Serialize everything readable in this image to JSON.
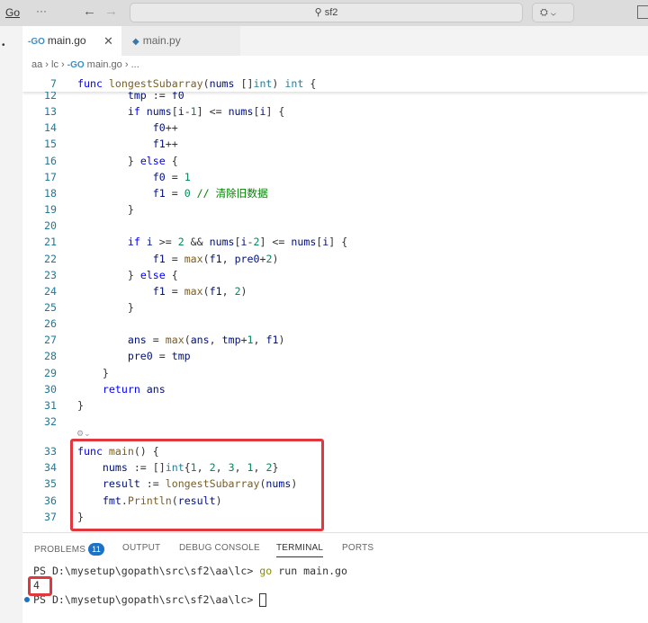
{
  "titlebar": {
    "menu": "Go",
    "more": "···",
    "search": "sf2"
  },
  "tabs": [
    {
      "label": "main.go",
      "icon": "go-icon",
      "active": true
    },
    {
      "label": "main.py",
      "icon": "python-icon",
      "active": false
    }
  ],
  "breadcrumb": [
    "aa",
    "lc",
    "main.go",
    "..."
  ],
  "sticky": {
    "num": "7",
    "tokens": [
      [
        "kw",
        "func "
      ],
      [
        "fn",
        "longestSubarray"
      ],
      [
        "pl",
        "("
      ],
      [
        "id",
        "nums "
      ],
      [
        "pl",
        "[]"
      ],
      [
        "ty",
        "int"
      ],
      [
        "pl",
        ") "
      ],
      [
        "ty",
        "int"
      ],
      [
        "pl",
        " {"
      ]
    ]
  },
  "lines": [
    {
      "num": "12",
      "tokens": [
        [
          "pl",
          "        "
        ],
        [
          "id",
          "tmp"
        ],
        [
          "pl",
          " := "
        ],
        [
          "id",
          "f0"
        ]
      ]
    },
    {
      "num": "13",
      "tokens": [
        [
          "pl",
          "        "
        ],
        [
          "kw",
          "if "
        ],
        [
          "id",
          "nums"
        ],
        [
          "pl",
          "["
        ],
        [
          "id",
          "i"
        ],
        [
          "pl",
          "-"
        ],
        [
          "num",
          "1"
        ],
        [
          "pl",
          "] <= "
        ],
        [
          "id",
          "nums"
        ],
        [
          "pl",
          "["
        ],
        [
          "id",
          "i"
        ],
        [
          "pl",
          "] {"
        ]
      ]
    },
    {
      "num": "14",
      "tokens": [
        [
          "pl",
          "            "
        ],
        [
          "id",
          "f0"
        ],
        [
          "pl",
          "++"
        ]
      ]
    },
    {
      "num": "15",
      "tokens": [
        [
          "pl",
          "            "
        ],
        [
          "id",
          "f1"
        ],
        [
          "pl",
          "++"
        ]
      ]
    },
    {
      "num": "16",
      "tokens": [
        [
          "pl",
          "        } "
        ],
        [
          "kw",
          "else"
        ],
        [
          "pl",
          " {"
        ]
      ]
    },
    {
      "num": "17",
      "tokens": [
        [
          "pl",
          "            "
        ],
        [
          "id",
          "f0"
        ],
        [
          "pl",
          " = "
        ],
        [
          "num",
          "1"
        ]
      ]
    },
    {
      "num": "18",
      "tokens": [
        [
          "pl",
          "            "
        ],
        [
          "id",
          "f1"
        ],
        [
          "pl",
          " = "
        ],
        [
          "num",
          "0"
        ],
        [
          "cm",
          " // 清除旧数据"
        ]
      ]
    },
    {
      "num": "19",
      "tokens": [
        [
          "pl",
          "        }"
        ]
      ]
    },
    {
      "num": "20",
      "tokens": []
    },
    {
      "num": "21",
      "tokens": [
        [
          "pl",
          "        "
        ],
        [
          "kw",
          "if "
        ],
        [
          "id",
          "i"
        ],
        [
          "pl",
          " >= "
        ],
        [
          "num",
          "2"
        ],
        [
          "pl",
          " && "
        ],
        [
          "id",
          "nums"
        ],
        [
          "pl",
          "["
        ],
        [
          "id",
          "i"
        ],
        [
          "pl",
          "-"
        ],
        [
          "num",
          "2"
        ],
        [
          "pl",
          "] <= "
        ],
        [
          "id",
          "nums"
        ],
        [
          "pl",
          "["
        ],
        [
          "id",
          "i"
        ],
        [
          "pl",
          "] {"
        ]
      ]
    },
    {
      "num": "22",
      "tokens": [
        [
          "pl",
          "            "
        ],
        [
          "id",
          "f1"
        ],
        [
          "pl",
          " = "
        ],
        [
          "fn",
          "max"
        ],
        [
          "pl",
          "("
        ],
        [
          "id",
          "f1"
        ],
        [
          "pl",
          ", "
        ],
        [
          "id",
          "pre0"
        ],
        [
          "pl",
          "+"
        ],
        [
          "num",
          "2"
        ],
        [
          "pl",
          ")"
        ]
      ]
    },
    {
      "num": "23",
      "tokens": [
        [
          "pl",
          "        } "
        ],
        [
          "kw",
          "else"
        ],
        [
          "pl",
          " {"
        ]
      ]
    },
    {
      "num": "24",
      "tokens": [
        [
          "pl",
          "            "
        ],
        [
          "id",
          "f1"
        ],
        [
          "pl",
          " = "
        ],
        [
          "fn",
          "max"
        ],
        [
          "pl",
          "("
        ],
        [
          "id",
          "f1"
        ],
        [
          "pl",
          ", "
        ],
        [
          "num",
          "2"
        ],
        [
          "pl",
          ")"
        ]
      ]
    },
    {
      "num": "25",
      "tokens": [
        [
          "pl",
          "        }"
        ]
      ]
    },
    {
      "num": "26",
      "tokens": []
    },
    {
      "num": "27",
      "tokens": [
        [
          "pl",
          "        "
        ],
        [
          "id",
          "ans"
        ],
        [
          "pl",
          " = "
        ],
        [
          "fn",
          "max"
        ],
        [
          "pl",
          "("
        ],
        [
          "id",
          "ans"
        ],
        [
          "pl",
          ", "
        ],
        [
          "id",
          "tmp"
        ],
        [
          "pl",
          "+"
        ],
        [
          "num",
          "1"
        ],
        [
          "pl",
          ", "
        ],
        [
          "id",
          "f1"
        ],
        [
          "pl",
          ")"
        ]
      ]
    },
    {
      "num": "28",
      "tokens": [
        [
          "pl",
          "        "
        ],
        [
          "id",
          "pre0"
        ],
        [
          "pl",
          " = "
        ],
        [
          "id",
          "tmp"
        ]
      ]
    },
    {
      "num": "29",
      "tokens": [
        [
          "pl",
          "    }"
        ]
      ]
    },
    {
      "num": "30",
      "tokens": [
        [
          "pl",
          "    "
        ],
        [
          "kw",
          "return "
        ],
        [
          "id",
          "ans"
        ]
      ]
    },
    {
      "num": "31",
      "tokens": [
        [
          "pl",
          "}"
        ]
      ]
    },
    {
      "num": "32",
      "tokens": []
    },
    {
      "num": "33",
      "tokens": [
        [
          "kw",
          "func "
        ],
        [
          "fn",
          "main"
        ],
        [
          "pl",
          "() {"
        ]
      ]
    },
    {
      "num": "34",
      "tokens": [
        [
          "pl",
          "    "
        ],
        [
          "id",
          "nums"
        ],
        [
          "pl",
          " := []"
        ],
        [
          "ty",
          "int"
        ],
        [
          "pl",
          "{"
        ],
        [
          "num",
          "1"
        ],
        [
          "pl",
          ", "
        ],
        [
          "num",
          "2"
        ],
        [
          "pl",
          ", "
        ],
        [
          "num",
          "3"
        ],
        [
          "pl",
          ", "
        ],
        [
          "num",
          "1"
        ],
        [
          "pl",
          ", "
        ],
        [
          "num",
          "2"
        ],
        [
          "pl",
          "}"
        ]
      ]
    },
    {
      "num": "35",
      "tokens": [
        [
          "pl",
          "    "
        ],
        [
          "id",
          "result"
        ],
        [
          "pl",
          " := "
        ],
        [
          "fn",
          "longestSubarray"
        ],
        [
          "pl",
          "("
        ],
        [
          "id",
          "nums"
        ],
        [
          "pl",
          ")"
        ]
      ]
    },
    {
      "num": "36",
      "tokens": [
        [
          "pl",
          "    "
        ],
        [
          "id",
          "fmt"
        ],
        [
          "pl",
          "."
        ],
        [
          "fn",
          "Println"
        ],
        [
          "pl",
          "("
        ],
        [
          "id",
          "result"
        ],
        [
          "pl",
          ")"
        ]
      ]
    },
    {
      "num": "37",
      "tokens": [
        [
          "pl",
          "}"
        ]
      ]
    }
  ],
  "panel": {
    "tabs": [
      "PROBLEMS",
      "OUTPUT",
      "DEBUG CONSOLE",
      "TERMINAL",
      "PORTS"
    ],
    "problems_count": "11",
    "active": "TERMINAL"
  },
  "terminal": {
    "prompt": "PS D:\\mysetup\\gopath\\src\\sf2\\aa\\lc> ",
    "cmd_go": "go",
    "cmd_rest": " run main.go",
    "output": "4"
  },
  "colors": {
    "highlight": "#e0383e",
    "accent": "#1a73c7"
  }
}
